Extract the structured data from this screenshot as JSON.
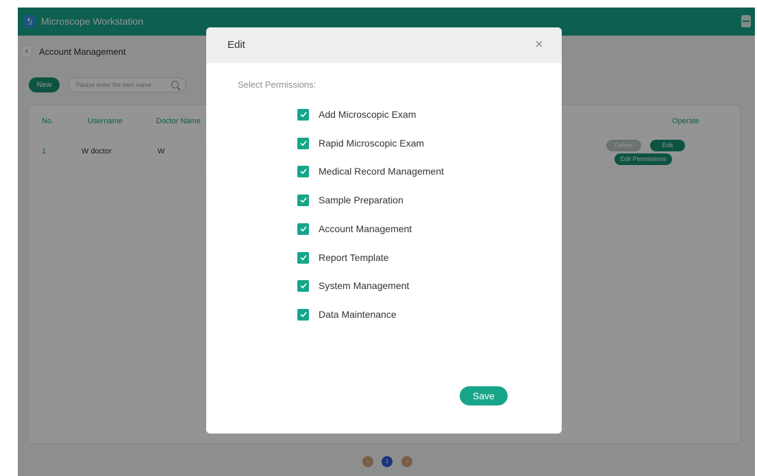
{
  "app": {
    "title": "Microscope Workstation"
  },
  "subheader": {
    "title": "Account Management"
  },
  "toolbar": {
    "new_label": "New",
    "search_placeholder": "Please enter the item name"
  },
  "table": {
    "headers": {
      "no": "No.",
      "username": "Username",
      "doctor_name": "Doctor Name",
      "operate": "Operate"
    },
    "rows": [
      {
        "no": "1",
        "username": "W doctor",
        "doctor_name": "W",
        "actions": {
          "delete": "Delete",
          "edit": "Edit",
          "edit_permissions": "Edit Permissions"
        }
      }
    ]
  },
  "pagination": {
    "prev": "‹",
    "current": "1",
    "next": "›"
  },
  "modal": {
    "title": "Edit",
    "close_icon": "close-icon",
    "section_label": "Select Permissions:",
    "permissions": [
      {
        "label": "Add Microscopic Exam",
        "checked": true
      },
      {
        "label": "Rapid Microscopic Exam",
        "checked": true
      },
      {
        "label": "Medical Record Management",
        "checked": true
      },
      {
        "label": "Sample Preparation",
        "checked": true
      },
      {
        "label": "Account Management",
        "checked": true
      },
      {
        "label": "Report Template",
        "checked": true
      },
      {
        "label": "System Management",
        "checked": true
      },
      {
        "label": "Data Maintenance",
        "checked": true
      }
    ],
    "save_label": "Save"
  },
  "colors": {
    "accent": "#17a589",
    "dark_accent": "#178f72",
    "overlay": "rgba(0,0,0,0.42)"
  }
}
